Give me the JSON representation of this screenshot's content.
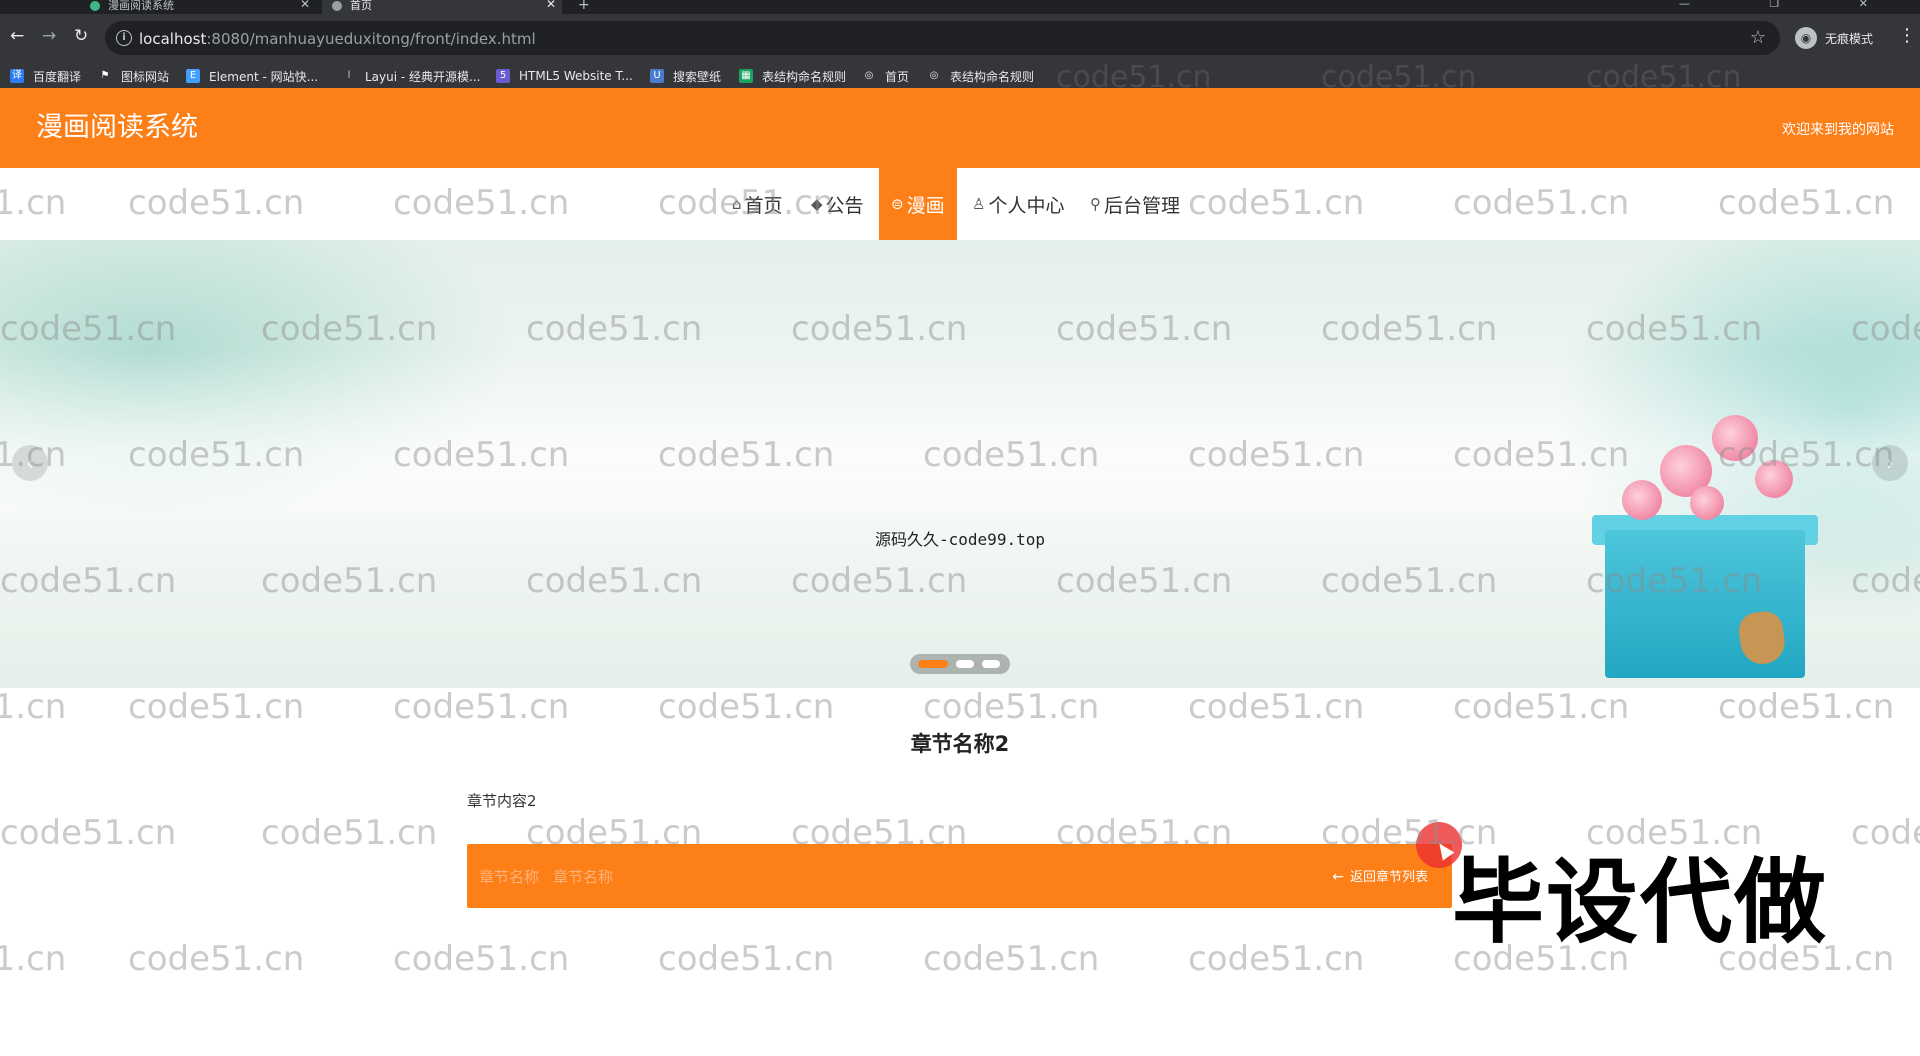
{
  "browser": {
    "tabs": [
      {
        "label": "漫画阅读系统"
      },
      {
        "label": "首页"
      }
    ],
    "new_tab": "+",
    "window_controls": "— ❐ ✕",
    "url_host": "localhost",
    "url_rest": ":8080/manhuayueduxitong/front/index.html",
    "incognito_label": "无痕模式",
    "bookmarks": [
      {
        "label": "百度翻译",
        "icon": "translate-icon",
        "color": "#2b7cf1"
      },
      {
        "label": "图标网站",
        "icon": "flag-icon",
        "color": "#ffffff"
      },
      {
        "label": "Element - 网站快...",
        "icon": "element-icon",
        "color": "#409eff"
      },
      {
        "label": "Layui - 经典开源模...",
        "icon": "layui-icon",
        "color": "#cccccc"
      },
      {
        "label": "HTML5 Website T...",
        "icon": "html5-icon",
        "color": "#6b5bd2"
      },
      {
        "label": "搜索壁纸",
        "icon": "wallpaper-icon",
        "color": "#4a7bd0"
      },
      {
        "label": "表结构命名规则",
        "icon": "sheet-icon",
        "color": "#1aa260"
      },
      {
        "label": "首页",
        "icon": "globe-icon",
        "color": "#e8eaed"
      },
      {
        "label": "表结构命名规则",
        "icon": "globe-icon",
        "color": "#e8eaed"
      }
    ]
  },
  "header": {
    "title": "漫画阅读系统",
    "welcome": "欢迎来到我的网站",
    "color": "#fc7f18"
  },
  "nav": {
    "items": [
      {
        "label": "首页",
        "icon": "home-icon",
        "glyph": "⌂",
        "active": false
      },
      {
        "label": "公告",
        "icon": "graduation-cap-icon",
        "glyph": "◆",
        "active": false
      },
      {
        "label": "漫画",
        "icon": "database-icon",
        "glyph": "⊜",
        "active": true
      },
      {
        "label": "个人中心",
        "icon": "user-icon",
        "glyph": "♙",
        "active": false
      },
      {
        "label": "后台管理",
        "icon": "link-icon",
        "glyph": "⚲",
        "active": false
      }
    ]
  },
  "carousel": {
    "caption": "源码久久-code99.top",
    "prev": "‹",
    "next": "›",
    "slide_count": 3,
    "active_slide": 1
  },
  "chapter": {
    "title": "章节名称2",
    "content": "章节内容2",
    "prev_label": "章节名称",
    "next_label": "章节名称",
    "back_icon": "←",
    "back_label": "返回章节列表"
  },
  "overlay_text": "毕设代做",
  "watermark": "code51.cn"
}
